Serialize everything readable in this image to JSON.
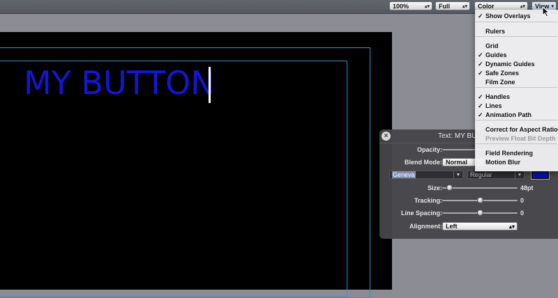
{
  "toolbar": {
    "zoom": "100%",
    "resolution": "Full",
    "channel": "Color",
    "view": "View"
  },
  "canvas": {
    "text": "MY BUTTON"
  },
  "hud": {
    "title": "Text: MY BU",
    "opacity_label": "Opacity:",
    "blend_label": "Blend Mode:",
    "blend_value": "Normal",
    "font_value": "Geneva",
    "style_value": "Regular",
    "size_label": "Size:",
    "size_value": "48pt",
    "size_level": 0.1,
    "tracking_label": "Tracking:",
    "tracking_value": "0",
    "tracking_level": 0.5,
    "linespacing_label": "Line Spacing:",
    "linespacing_value": "0",
    "linespacing_level": 0.5,
    "alignment_label": "Alignment:",
    "alignment_value": "Left",
    "color": "#1010b0"
  },
  "view_menu": {
    "items": [
      {
        "label": "Show Overlays",
        "checked": true
      },
      {
        "label": "Rulers",
        "checked": false
      },
      {
        "label": "Grid",
        "checked": false
      },
      {
        "label": "Guides",
        "checked": true
      },
      {
        "label": "Dynamic Guides",
        "checked": true
      },
      {
        "label": "Safe Zones",
        "checked": true
      },
      {
        "label": "Film Zone",
        "checked": false
      },
      {
        "label": "Handles",
        "checked": true
      },
      {
        "label": "Lines",
        "checked": true
      },
      {
        "label": "Animation Path",
        "checked": true
      },
      {
        "label": "Correct for Aspect Ratio",
        "checked": false
      },
      {
        "label": "Preview Float Bit Depth",
        "checked": false,
        "disabled": true
      },
      {
        "label": "Field Rendering",
        "checked": false
      },
      {
        "label": "Motion Blur",
        "checked": false
      }
    ],
    "checkmark": "✓"
  }
}
